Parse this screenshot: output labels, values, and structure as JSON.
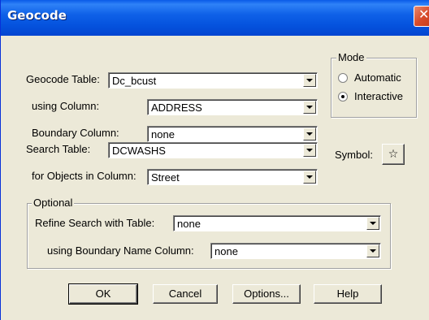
{
  "window": {
    "title": "Geocode",
    "close_glyph": "✕"
  },
  "geocode_table": {
    "label": "Geocode Table:",
    "value": "Dc_bcust"
  },
  "using_column": {
    "label": "using Column:",
    "value": "ADDRESS"
  },
  "boundary_column": {
    "label": "Boundary Column:",
    "value": "none"
  },
  "mode": {
    "title": "Mode",
    "options": [
      {
        "label": "Automatic",
        "selected": false
      },
      {
        "label": "Interactive",
        "selected": true
      }
    ]
  },
  "search_table": {
    "label": "Search Table:",
    "value": "DCWASHS"
  },
  "objects_column": {
    "label": "for Objects in Column:",
    "value": "Street"
  },
  "symbol": {
    "label": "Symbol:",
    "icon": "star-icon",
    "glyph": "☆"
  },
  "optional": {
    "title": "Optional",
    "refine_table": {
      "label": "Refine Search with Table:",
      "value": "none"
    },
    "boundary_name_column": {
      "label": "using Boundary Name Column:",
      "value": "none"
    }
  },
  "buttons": {
    "ok": "OK",
    "cancel": "Cancel",
    "options": "Options...",
    "help": "Help"
  }
}
